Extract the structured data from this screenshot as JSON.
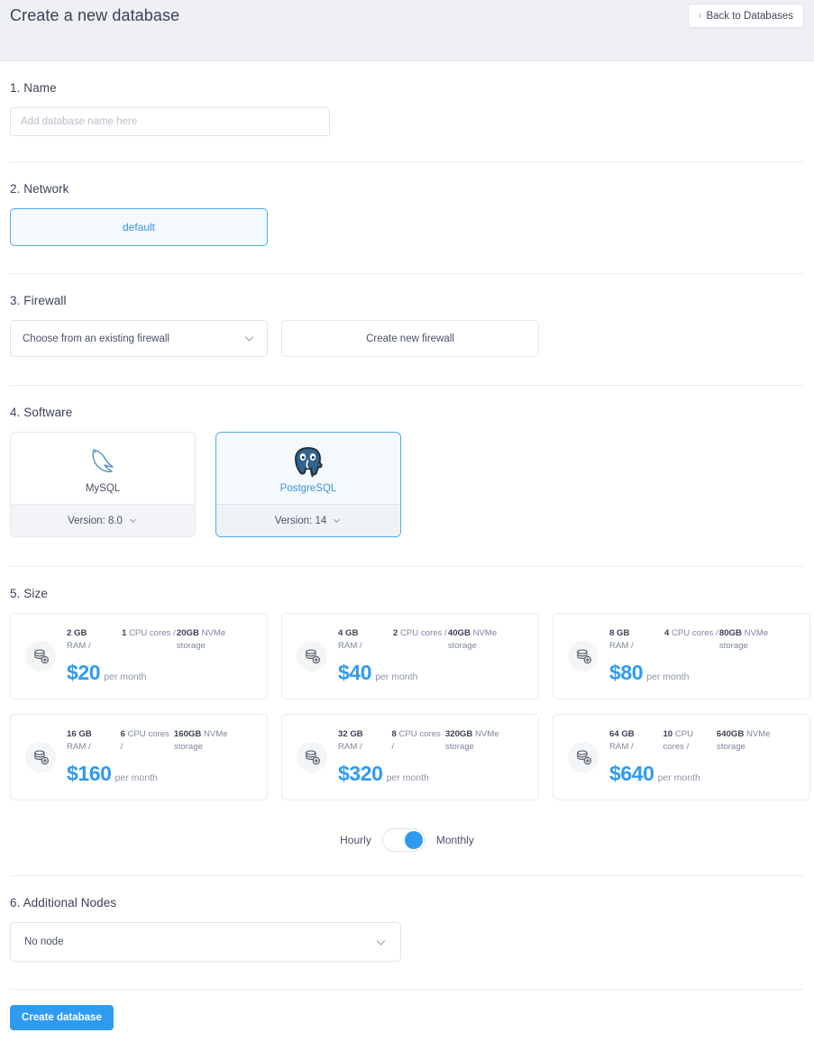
{
  "header": {
    "title": "Create a new database",
    "back_label": "Back to Databases",
    "back_chevron": "‹"
  },
  "sections": {
    "name": {
      "title": "1. Name",
      "placeholder": "Add database name here",
      "value": ""
    },
    "network": {
      "title": "2. Network",
      "option_label": "default"
    },
    "firewall": {
      "title": "3. Firewall",
      "select_label": "Choose from an existing firewall",
      "create_label": "Create new firewall"
    },
    "software": {
      "title": "4. Software",
      "options": [
        {
          "name": "MySQL",
          "version_label": "Version: 8.0",
          "selected": false
        },
        {
          "name": "PostgreSQL",
          "version_label": "Version: 14",
          "selected": true
        }
      ]
    },
    "size": {
      "title": "5. Size",
      "plans": [
        {
          "ram": "2 GB",
          "ram_label": "RAM /",
          "cpu": "1",
          "cpu_label": "CPU cores /",
          "disk": "20GB",
          "disk_label": "NVMe storage",
          "price": "$20",
          "price_unit": "per month"
        },
        {
          "ram": "4 GB",
          "ram_label": "RAM /",
          "cpu": "2",
          "cpu_label": "CPU cores /",
          "disk": "40GB",
          "disk_label": "NVMe storage",
          "price": "$40",
          "price_unit": "per month"
        },
        {
          "ram": "8 GB",
          "ram_label": "RAM /",
          "cpu": "4",
          "cpu_label": "CPU cores /",
          "disk": "80GB",
          "disk_label": "NVMe storage",
          "price": "$80",
          "price_unit": "per month"
        },
        {
          "ram": "16 GB",
          "ram_label": "RAM /",
          "cpu": "6",
          "cpu_label": "CPU cores /",
          "disk": "160GB",
          "disk_label": "NVMe storage",
          "price": "$160",
          "price_unit": "per month"
        },
        {
          "ram": "32 GB",
          "ram_label": "RAM /",
          "cpu": "8",
          "cpu_label": "CPU cores /",
          "disk": "320GB",
          "disk_label": "NVMe storage",
          "price": "$320",
          "price_unit": "per month"
        },
        {
          "ram": "64 GB",
          "ram_label": "RAM /",
          "cpu": "10",
          "cpu_label": "CPU cores /",
          "disk": "640GB",
          "disk_label": "NVMe storage",
          "price": "$640",
          "price_unit": "per month"
        }
      ],
      "billing_toggle": {
        "left_label": "Hourly",
        "right_label": "Monthly",
        "selected": "Monthly"
      }
    },
    "nodes": {
      "title": "6. Additional Nodes",
      "selected": "No node"
    }
  },
  "submit": {
    "label": "Create database"
  },
  "colors": {
    "accent": "#2f9bef",
    "selected_border": "#53a8e8",
    "selected_bg": "#f4f9fd",
    "header_bg": "#eff0f3",
    "text": "#3c4257",
    "muted": "#7d8699"
  }
}
